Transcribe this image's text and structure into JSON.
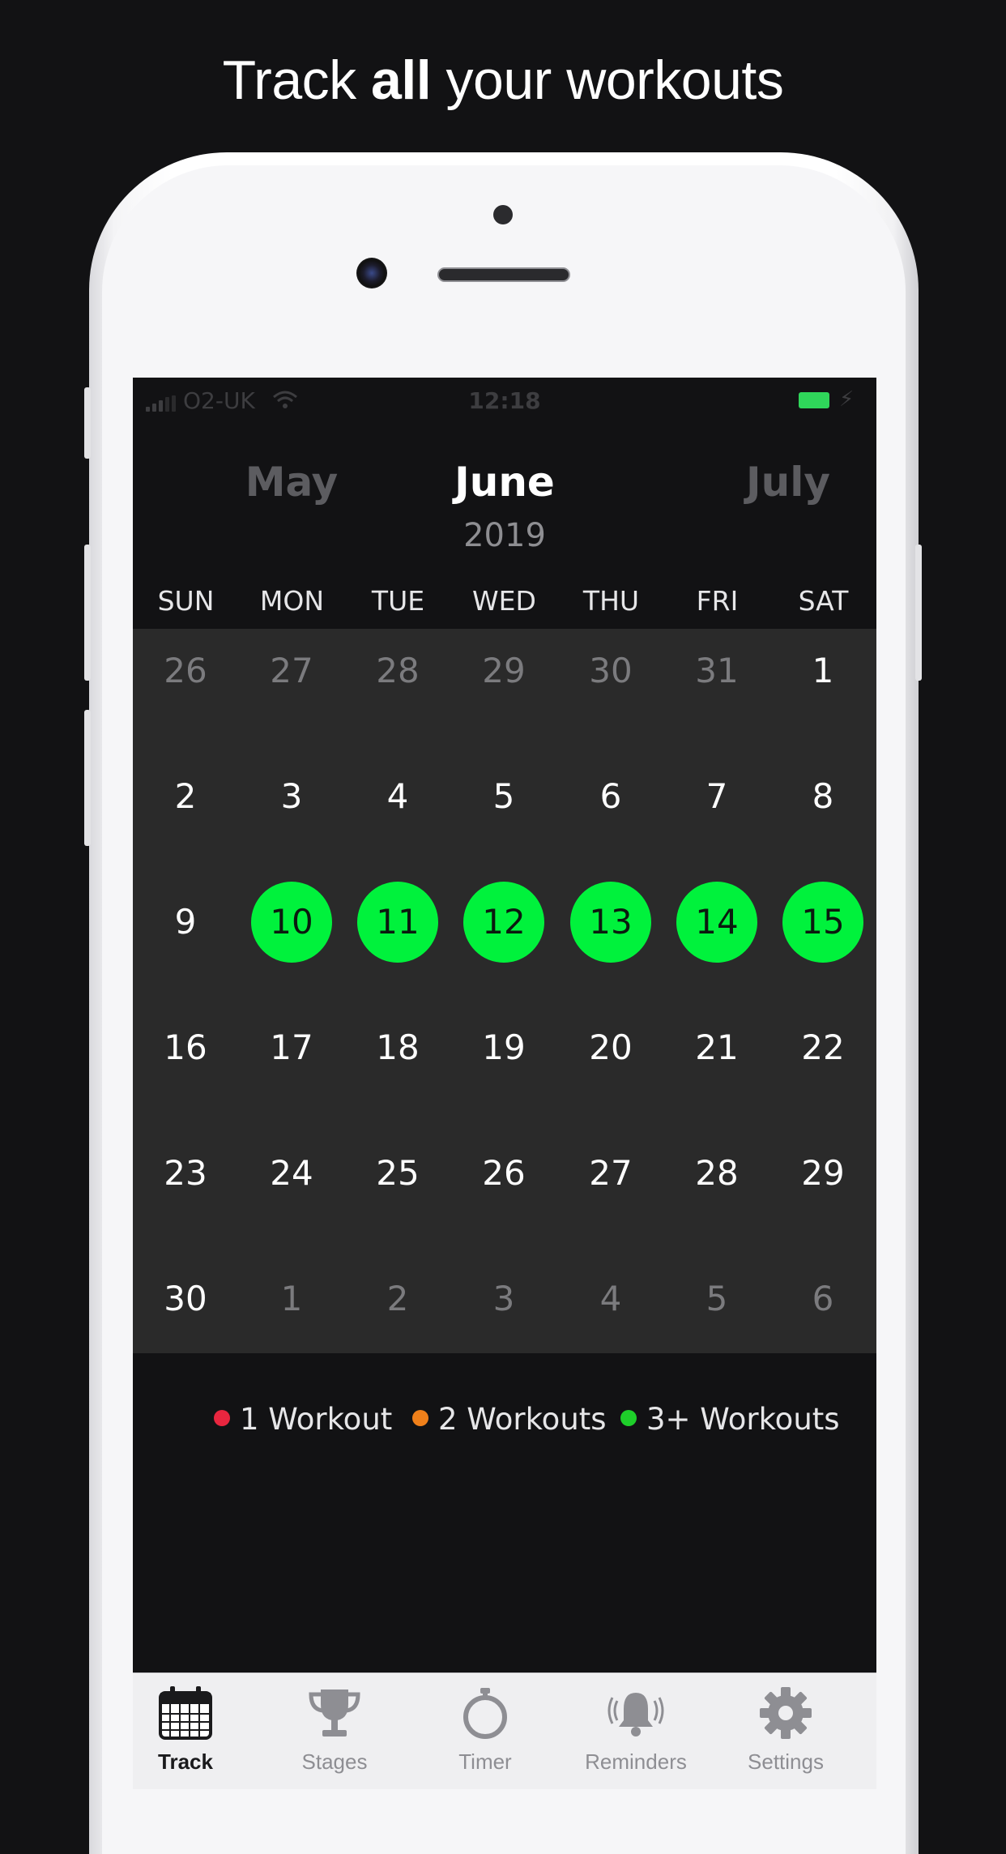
{
  "headline": {
    "pre": "Track ",
    "bold": "all",
    "post": " your workouts"
  },
  "status_bar": {
    "carrier": "O2-UK",
    "time": "12:18"
  },
  "calendar": {
    "prev_month": "May",
    "current_month": "June",
    "next_month": "July",
    "year": "2019",
    "weekdays": [
      "SUN",
      "MON",
      "TUE",
      "WED",
      "THU",
      "FRI",
      "SAT"
    ],
    "weeks": [
      [
        {
          "d": "26",
          "s": "dim"
        },
        {
          "d": "27",
          "s": "dim"
        },
        {
          "d": "28",
          "s": "dim"
        },
        {
          "d": "29",
          "s": "dim"
        },
        {
          "d": "30",
          "s": "dim"
        },
        {
          "d": "31",
          "s": "dim"
        },
        {
          "d": "1",
          "s": "normal"
        }
      ],
      [
        {
          "d": "2",
          "s": "normal"
        },
        {
          "d": "3",
          "s": "normal"
        },
        {
          "d": "4",
          "s": "normal"
        },
        {
          "d": "5",
          "s": "normal"
        },
        {
          "d": "6",
          "s": "normal"
        },
        {
          "d": "7",
          "s": "normal"
        },
        {
          "d": "8",
          "s": "normal"
        }
      ],
      [
        {
          "d": "9",
          "s": "normal"
        },
        {
          "d": "10",
          "s": "active"
        },
        {
          "d": "11",
          "s": "active"
        },
        {
          "d": "12",
          "s": "active"
        },
        {
          "d": "13",
          "s": "active"
        },
        {
          "d": "14",
          "s": "active"
        },
        {
          "d": "15",
          "s": "active"
        }
      ],
      [
        {
          "d": "16",
          "s": "normal"
        },
        {
          "d": "17",
          "s": "normal"
        },
        {
          "d": "18",
          "s": "normal"
        },
        {
          "d": "19",
          "s": "normal"
        },
        {
          "d": "20",
          "s": "normal"
        },
        {
          "d": "21",
          "s": "normal"
        },
        {
          "d": "22",
          "s": "normal"
        }
      ],
      [
        {
          "d": "23",
          "s": "normal"
        },
        {
          "d": "24",
          "s": "normal"
        },
        {
          "d": "25",
          "s": "normal"
        },
        {
          "d": "26",
          "s": "normal"
        },
        {
          "d": "27",
          "s": "normal"
        },
        {
          "d": "28",
          "s": "normal"
        },
        {
          "d": "29",
          "s": "normal"
        }
      ],
      [
        {
          "d": "30",
          "s": "normal"
        },
        {
          "d": "1",
          "s": "dim"
        },
        {
          "d": "2",
          "s": "dim"
        },
        {
          "d": "3",
          "s": "dim"
        },
        {
          "d": "4",
          "s": "dim"
        },
        {
          "d": "5",
          "s": "dim"
        },
        {
          "d": "6",
          "s": "dim"
        }
      ]
    ]
  },
  "legend": [
    {
      "label": "1 Workout",
      "color": "#e8263f"
    },
    {
      "label": "2 Workouts",
      "color": "#f0801a"
    },
    {
      "label": "3+ Workouts",
      "color": "#1ecf2a"
    }
  ],
  "tabs": [
    {
      "label": "Track",
      "icon": "calendar-icon",
      "active": true
    },
    {
      "label": "Stages",
      "icon": "trophy-icon",
      "active": false
    },
    {
      "label": "Timer",
      "icon": "stopwatch-icon",
      "active": false
    },
    {
      "label": "Reminders",
      "icon": "bell-icon",
      "active": false
    },
    {
      "label": "Settings",
      "icon": "gear-icon",
      "active": false
    }
  ],
  "colors": {
    "background": "#121214",
    "grid": "#2a2a2a",
    "active_day": "#00f23c",
    "battery": "#2fd65a"
  }
}
